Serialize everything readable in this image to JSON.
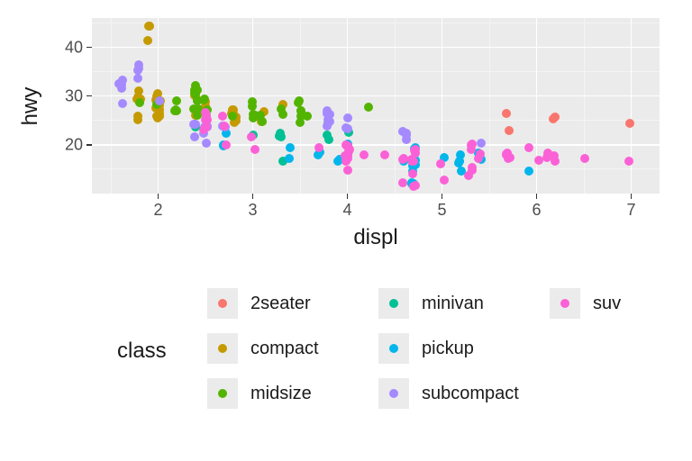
{
  "chart_data": {
    "type": "scatter",
    "title": "",
    "xlabel": "displ",
    "ylabel": "hwy",
    "xlim": [
      1.3,
      7.3
    ],
    "ylim": [
      10,
      46
    ],
    "x_ticks": [
      2,
      3,
      4,
      5,
      6,
      7
    ],
    "y_ticks": [
      20,
      30,
      40
    ],
    "x_minor": [
      1.5,
      2.5,
      3.5,
      4.5,
      5.5,
      6.5
    ],
    "y_minor": [
      15,
      25,
      35,
      45
    ],
    "legend_title": "class",
    "colors": {
      "2seater": "#F8766D",
      "compact": "#C49A00",
      "midsize": "#53B400",
      "minivan": "#00C094",
      "pickup": "#00B6EB",
      "subcompact": "#A58AFF",
      "suv": "#FB61D7"
    },
    "legend_order": [
      "2seater",
      "compact",
      "midsize",
      "minivan",
      "pickup",
      "subcompact",
      "suv"
    ],
    "legend_layout": [
      [
        "2seater",
        "compact",
        "midsize"
      ],
      [
        "minivan",
        "pickup",
        "subcompact"
      ],
      [
        "suv"
      ]
    ],
    "series": [
      {
        "name": "2seater",
        "points": [
          [
            5.7,
            26
          ],
          [
            5.7,
            23
          ],
          [
            6.2,
            26
          ],
          [
            6.2,
            25
          ],
          [
            7.0,
            24
          ]
        ]
      },
      {
        "name": "compact",
        "points": [
          [
            1.8,
            29
          ],
          [
            1.8,
            29
          ],
          [
            2.0,
            31
          ],
          [
            2.0,
            30
          ],
          [
            2.8,
            26
          ],
          [
            2.8,
            26
          ],
          [
            3.1,
            27
          ],
          [
            1.8,
            26
          ],
          [
            1.8,
            25
          ],
          [
            2.0,
            28
          ],
          [
            2.0,
            27
          ],
          [
            2.8,
            25
          ],
          [
            2.8,
            25
          ],
          [
            3.1,
            25
          ],
          [
            3.1,
            25
          ],
          [
            2.4,
            30
          ],
          [
            3.3,
            28
          ],
          [
            2.0,
            26
          ],
          [
            2.0,
            29
          ],
          [
            2.0,
            29
          ],
          [
            2.0,
            29
          ],
          [
            2.0,
            28
          ],
          [
            2.0,
            29
          ],
          [
            2.0,
            28
          ],
          [
            2.0,
            26
          ],
          [
            2.0,
            26
          ],
          [
            2.4,
            26
          ],
          [
            2.4,
            27
          ],
          [
            2.5,
            26
          ],
          [
            2.5,
            27
          ],
          [
            2.8,
            27
          ],
          [
            2.8,
            26
          ],
          [
            1.9,
            44
          ],
          [
            2.0,
            29
          ],
          [
            2.0,
            26
          ],
          [
            2.5,
            28
          ],
          [
            2.5,
            29
          ],
          [
            1.8,
            29
          ],
          [
            1.8,
            29
          ],
          [
            1.8,
            30
          ],
          [
            1.8,
            31
          ],
          [
            2.0,
            26
          ],
          [
            2.8,
            26
          ],
          [
            2.8,
            27
          ],
          [
            1.9,
            44
          ],
          [
            1.9,
            41
          ],
          [
            2.0,
            29
          ]
        ]
      },
      {
        "name": "midsize",
        "points": [
          [
            2.8,
            26
          ],
          [
            3.1,
            25
          ],
          [
            4.2,
            28
          ],
          [
            3.0,
            26
          ],
          [
            3.5,
            29
          ],
          [
            2.4,
            27
          ],
          [
            2.4,
            30
          ],
          [
            3.1,
            26
          ],
          [
            3.5,
            29
          ],
          [
            3.6,
            26
          ],
          [
            2.4,
            27
          ],
          [
            2.4,
            29
          ],
          [
            2.4,
            31
          ],
          [
            2.4,
            32
          ],
          [
            2.5,
            27
          ],
          [
            2.4,
            26
          ],
          [
            2.4,
            29
          ],
          [
            3.0,
            28
          ],
          [
            3.5,
            27
          ],
          [
            3.5,
            25
          ],
          [
            3.0,
            26
          ],
          [
            3.0,
            29
          ],
          [
            3.3,
            26
          ],
          [
            3.3,
            27
          ],
          [
            2.5,
            29
          ],
          [
            2.5,
            29
          ],
          [
            3.5,
            26
          ],
          [
            2.2,
            27
          ],
          [
            2.2,
            27
          ],
          [
            2.4,
            31
          ],
          [
            2.4,
            31
          ],
          [
            3.0,
            26
          ],
          [
            3.0,
            26
          ],
          [
            3.5,
            27
          ],
          [
            2.2,
            29
          ],
          [
            2.2,
            27
          ],
          [
            2.4,
            31
          ],
          [
            2.4,
            31
          ],
          [
            3.0,
            26
          ],
          [
            1.8,
            29
          ],
          [
            2.0,
            28
          ]
        ]
      },
      {
        "name": "minivan",
        "points": [
          [
            2.4,
            24
          ],
          [
            3.0,
            22
          ],
          [
            3.3,
            22
          ],
          [
            3.3,
            22
          ],
          [
            3.3,
            22
          ],
          [
            3.3,
            17
          ],
          [
            3.3,
            22
          ],
          [
            3.8,
            24
          ],
          [
            3.8,
            22
          ],
          [
            3.8,
            21
          ],
          [
            4.0,
            23
          ]
        ]
      },
      {
        "name": "pickup",
        "points": [
          [
            3.7,
            19
          ],
          [
            3.7,
            18
          ],
          [
            3.9,
            17
          ],
          [
            3.9,
            17
          ],
          [
            4.7,
            19
          ],
          [
            4.7,
            19
          ],
          [
            4.7,
            12
          ],
          [
            5.2,
            17
          ],
          [
            5.2,
            15
          ],
          [
            5.2,
            16
          ],
          [
            5.7,
            17
          ],
          [
            5.9,
            15
          ],
          [
            4.7,
            12
          ],
          [
            4.7,
            17
          ],
          [
            4.7,
            16
          ],
          [
            4.7,
            12
          ],
          [
            4.7,
            17
          ],
          [
            4.7,
            15
          ],
          [
            4.7,
            16
          ],
          [
            5.2,
            18
          ],
          [
            5.2,
            17
          ],
          [
            2.7,
            20
          ],
          [
            2.7,
            20
          ],
          [
            2.7,
            22
          ],
          [
            3.4,
            17
          ],
          [
            3.4,
            19
          ],
          [
            4.0,
            20
          ],
          [
            4.0,
            17
          ],
          [
            4.0,
            20
          ],
          [
            4.6,
            17
          ],
          [
            5.0,
            17
          ],
          [
            5.4,
            17
          ],
          [
            5.4,
            18
          ]
        ]
      },
      {
        "name": "subcompact",
        "points": [
          [
            3.8,
            26
          ],
          [
            3.8,
            25
          ],
          [
            3.8,
            26
          ],
          [
            3.8,
            24
          ],
          [
            3.8,
            27
          ],
          [
            3.8,
            25
          ],
          [
            4.0,
            23
          ],
          [
            4.0,
            24
          ],
          [
            4.0,
            26
          ],
          [
            4.6,
            21
          ],
          [
            4.6,
            22
          ],
          [
            4.6,
            23
          ],
          [
            4.6,
            22
          ],
          [
            5.4,
            20
          ],
          [
            1.6,
            33
          ],
          [
            1.6,
            32
          ],
          [
            1.6,
            32
          ],
          [
            1.6,
            29
          ],
          [
            1.6,
            32
          ],
          [
            1.8,
            34
          ],
          [
            1.8,
            36
          ],
          [
            1.8,
            36
          ],
          [
            2.0,
            29
          ],
          [
            2.4,
            24
          ],
          [
            2.4,
            24
          ],
          [
            2.4,
            24
          ],
          [
            2.4,
            22
          ],
          [
            2.5,
            24
          ],
          [
            2.5,
            24
          ],
          [
            2.5,
            24
          ],
          [
            2.5,
            22
          ],
          [
            2.5,
            20
          ],
          [
            2.7,
            24
          ],
          [
            2.7,
            24
          ],
          [
            1.8,
            35
          ]
        ]
      },
      {
        "name": "suv",
        "points": [
          [
            5.3,
            20
          ],
          [
            5.3,
            15
          ],
          [
            5.3,
            20
          ],
          [
            5.7,
            17
          ],
          [
            6.0,
            17
          ],
          [
            5.7,
            18
          ],
          [
            5.7,
            17
          ],
          [
            6.2,
            18
          ],
          [
            6.2,
            17
          ],
          [
            7.0,
            17
          ],
          [
            6.5,
            17
          ],
          [
            2.7,
            20
          ],
          [
            3.0,
            19
          ],
          [
            4.0,
            17
          ],
          [
            4.0,
            19
          ],
          [
            4.0,
            18
          ],
          [
            4.0,
            17
          ],
          [
            4.6,
            17
          ],
          [
            5.0,
            16
          ],
          [
            4.2,
            18
          ],
          [
            4.4,
            18
          ],
          [
            4.6,
            17
          ],
          [
            5.4,
            17
          ],
          [
            5.4,
            18
          ],
          [
            2.5,
            25
          ],
          [
            2.5,
            24
          ],
          [
            2.5,
            27
          ],
          [
            2.5,
            25
          ],
          [
            2.5,
            26
          ],
          [
            2.5,
            23
          ],
          [
            2.7,
            24
          ],
          [
            2.7,
            26
          ],
          [
            4.0,
            15
          ],
          [
            4.0,
            18
          ],
          [
            4.0,
            17
          ],
          [
            4.0,
            19
          ],
          [
            4.7,
            17
          ],
          [
            4.7,
            19
          ],
          [
            4.7,
            19
          ],
          [
            5.7,
            17
          ],
          [
            6.1,
            17
          ],
          [
            5.3,
            19
          ],
          [
            5.3,
            14
          ],
          [
            5.3,
            15
          ],
          [
            5.7,
            18
          ],
          [
            5.9,
            19
          ],
          [
            4.7,
            12
          ],
          [
            4.7,
            12
          ],
          [
            4.7,
            14
          ],
          [
            4.0,
            18
          ],
          [
            4.0,
            20
          ],
          [
            4.6,
            12
          ],
          [
            5.0,
            13
          ],
          [
            3.0,
            22
          ],
          [
            3.7,
            19
          ],
          [
            4.0,
            20
          ],
          [
            4.7,
            17
          ],
          [
            4.7,
            17
          ],
          [
            4.7,
            18
          ],
          [
            5.7,
            18
          ],
          [
            6.1,
            18
          ],
          [
            4.0,
            20
          ]
        ]
      }
    ]
  }
}
